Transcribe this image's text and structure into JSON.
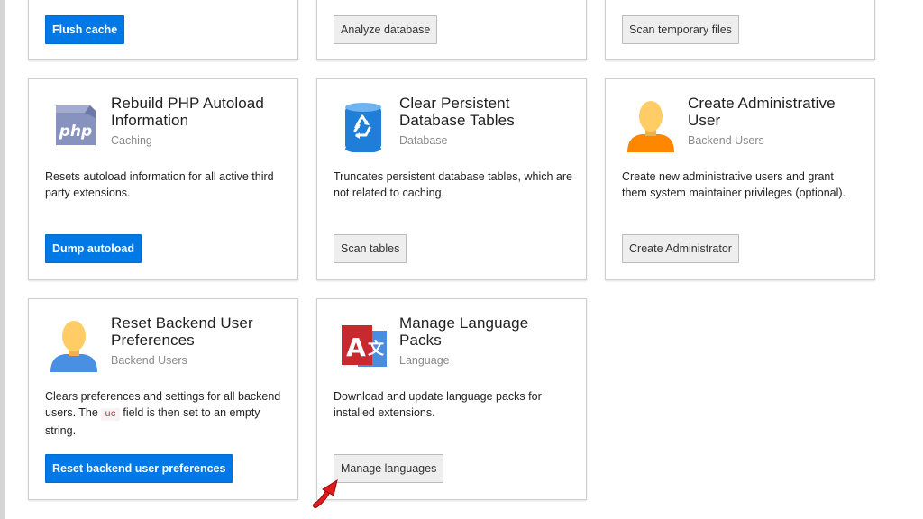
{
  "top_row": [
    {
      "button": "Flush cache",
      "style": "primary"
    },
    {
      "button": "Analyze database",
      "style": "default"
    },
    {
      "button": "Scan temporary files",
      "style": "default"
    }
  ],
  "cards": {
    "autoload": {
      "title": "Rebuild PHP Autoload Information",
      "category": "Caching",
      "description": "Resets autoload information for all active third party extensions.",
      "button": "Dump autoload",
      "icon": "php-icon"
    },
    "persistent_tables": {
      "title": "Clear Persistent Database Tables",
      "category": "Database",
      "description": "Truncates persistent database tables, which are not related to caching.",
      "button": "Scan tables",
      "icon": "recycle-database-icon"
    },
    "create_admin": {
      "title": "Create Administrative User",
      "category": "Backend Users",
      "description": "Create new administrative users and grant them system maintainer privileges (optional).",
      "button": "Create Administrator",
      "icon": "admin-user-icon"
    },
    "reset_prefs": {
      "title": "Reset Backend User Preferences",
      "category": "Backend Users",
      "description_before": "Clears preferences and settings for all backend users. The ",
      "description_code": "uc",
      "description_after": " field is then set to an empty string.",
      "button": "Reset backend user preferences",
      "icon": "backend-user-icon"
    },
    "language": {
      "title": "Manage Language Packs",
      "category": "Language",
      "description": "Download and update language packs for installed extensions.",
      "button": "Manage languages",
      "icon": "translate-icon"
    }
  },
  "colors": {
    "primary": "#0078e6",
    "admin_shirt": "#ff8700",
    "user_shirt": "#4a90e2",
    "skin": "#ffcc66",
    "php_purple": "#8892bf",
    "db_blue": "#1f7fd8",
    "language_red": "#c62a2f",
    "language_blue": "#4a8de0",
    "pointer_red": "#e01b1b"
  }
}
